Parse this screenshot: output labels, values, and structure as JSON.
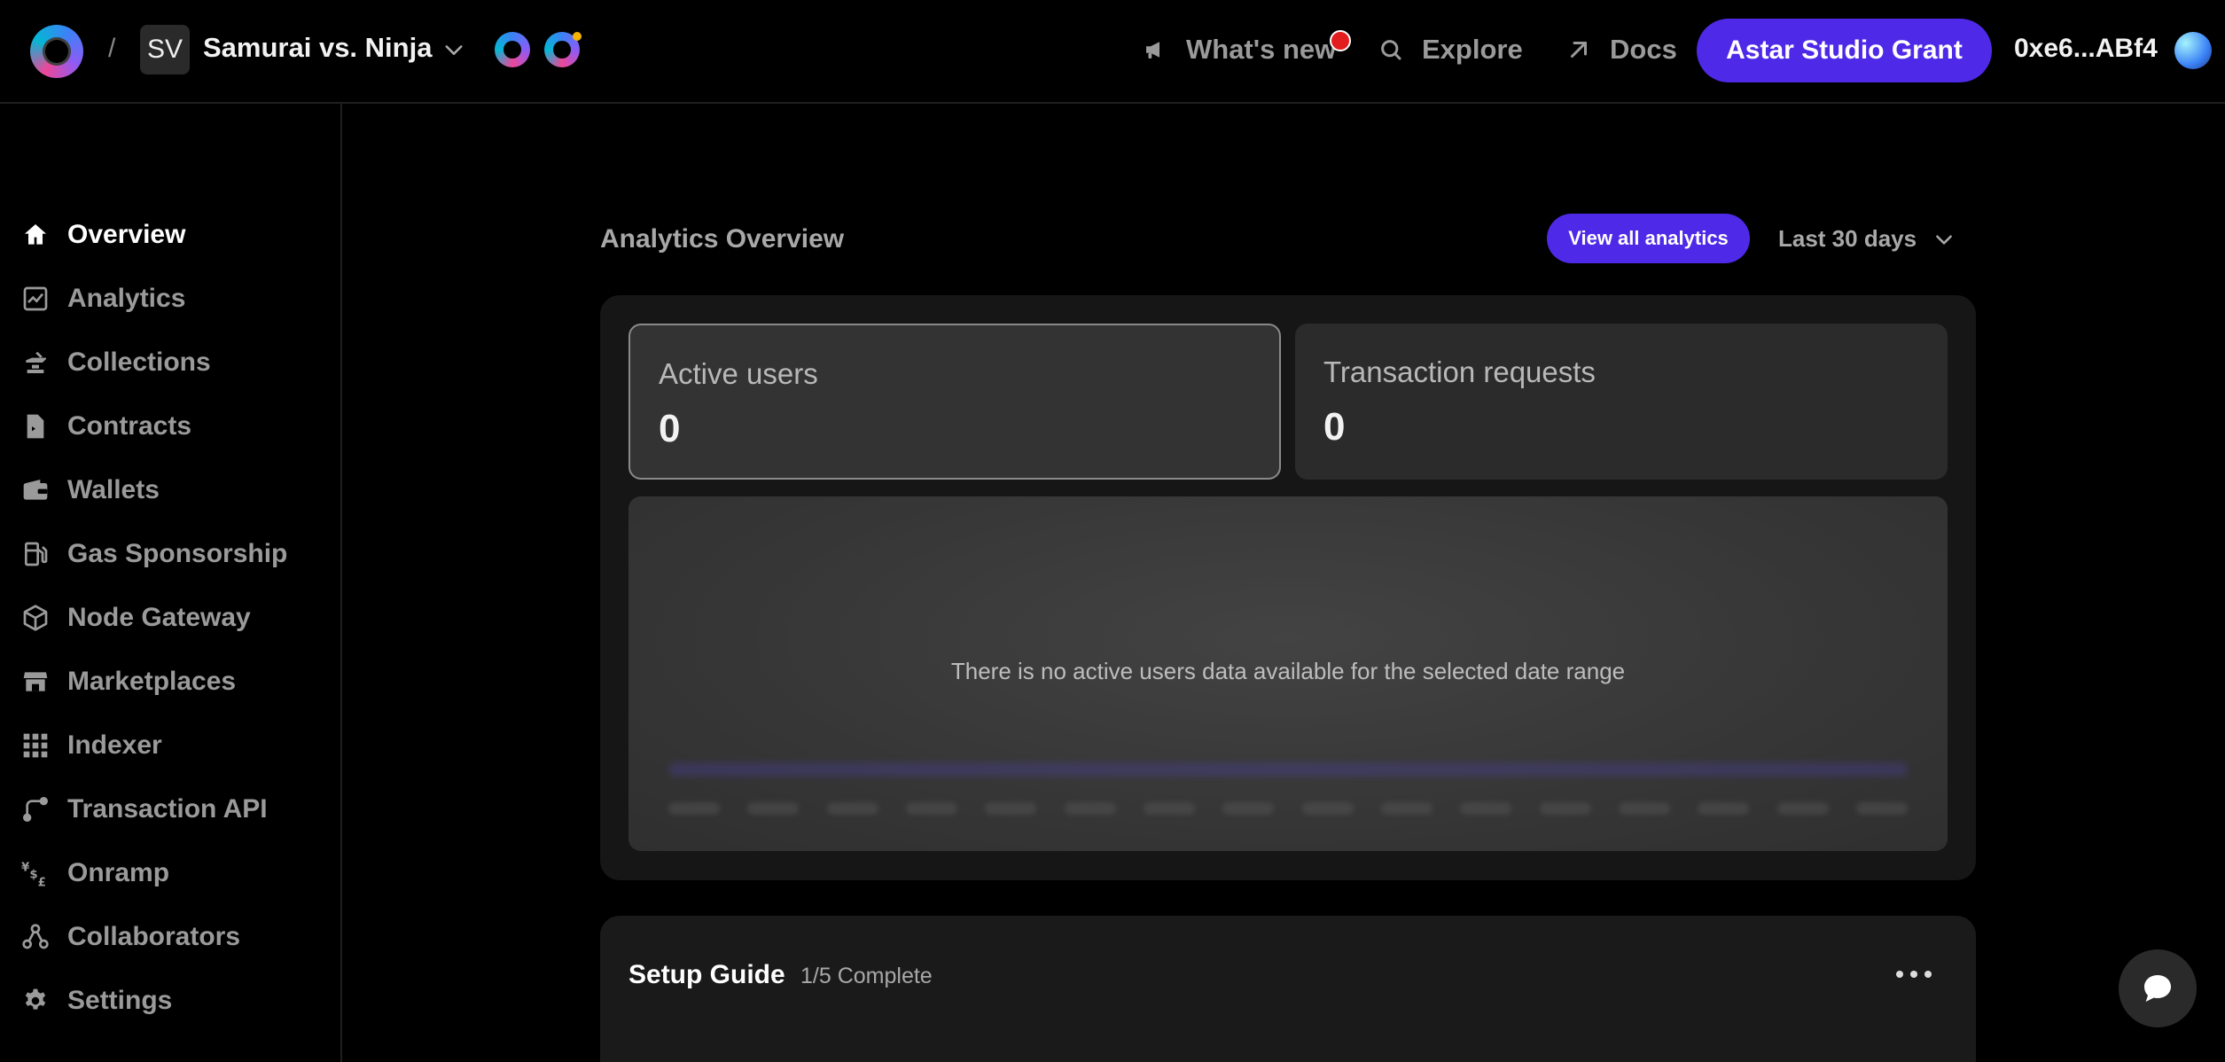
{
  "header": {
    "separator": "/",
    "project_initials": "SV",
    "project_name": "Samurai vs. Ninja",
    "links": {
      "whats_new": "What's new",
      "explore": "Explore",
      "docs": "Docs"
    },
    "grant_button": "Astar Studio Grant",
    "wallet_address": "0xe6...ABf4",
    "icons": [
      "app-logo-icon",
      "chevron-down-icon",
      "chain-icon",
      "megaphone-icon",
      "search-icon",
      "arrow-up-right-icon",
      "wallet-avatar"
    ]
  },
  "sidebar": {
    "items": [
      {
        "label": "Overview",
        "icon": "home-icon",
        "active": true
      },
      {
        "label": "Analytics",
        "icon": "chart-icon"
      },
      {
        "label": "Collections",
        "icon": "anvil-icon"
      },
      {
        "label": "Contracts",
        "icon": "contract-icon"
      },
      {
        "label": "Wallets",
        "icon": "wallet-icon"
      },
      {
        "label": "Gas Sponsorship",
        "icon": "fuel-icon"
      },
      {
        "label": "Node Gateway",
        "icon": "cube-icon"
      },
      {
        "label": "Marketplaces",
        "icon": "storefront-icon"
      },
      {
        "label": "Indexer",
        "icon": "grid-icon"
      },
      {
        "label": "Transaction API",
        "icon": "route-icon"
      },
      {
        "label": "Onramp",
        "icon": "currency-icon"
      },
      {
        "label": "Collaborators",
        "icon": "collaborators-icon"
      },
      {
        "label": "Settings",
        "icon": "gear-icon"
      }
    ]
  },
  "analytics": {
    "title": "Analytics Overview",
    "view_all": "View all analytics",
    "range": "Last 30 days",
    "stats": [
      {
        "label": "Active users",
        "value": "0"
      },
      {
        "label": "Transaction requests",
        "value": "0"
      }
    ],
    "empty_message": "There is no active users data available for the selected date range"
  },
  "setup_guide": {
    "title": "Setup Guide",
    "progress": "1/5 Complete"
  },
  "colors": {
    "accent": "#4f29e8",
    "notification": "#e11d1d",
    "background": "#000000",
    "panel": "#161616"
  }
}
